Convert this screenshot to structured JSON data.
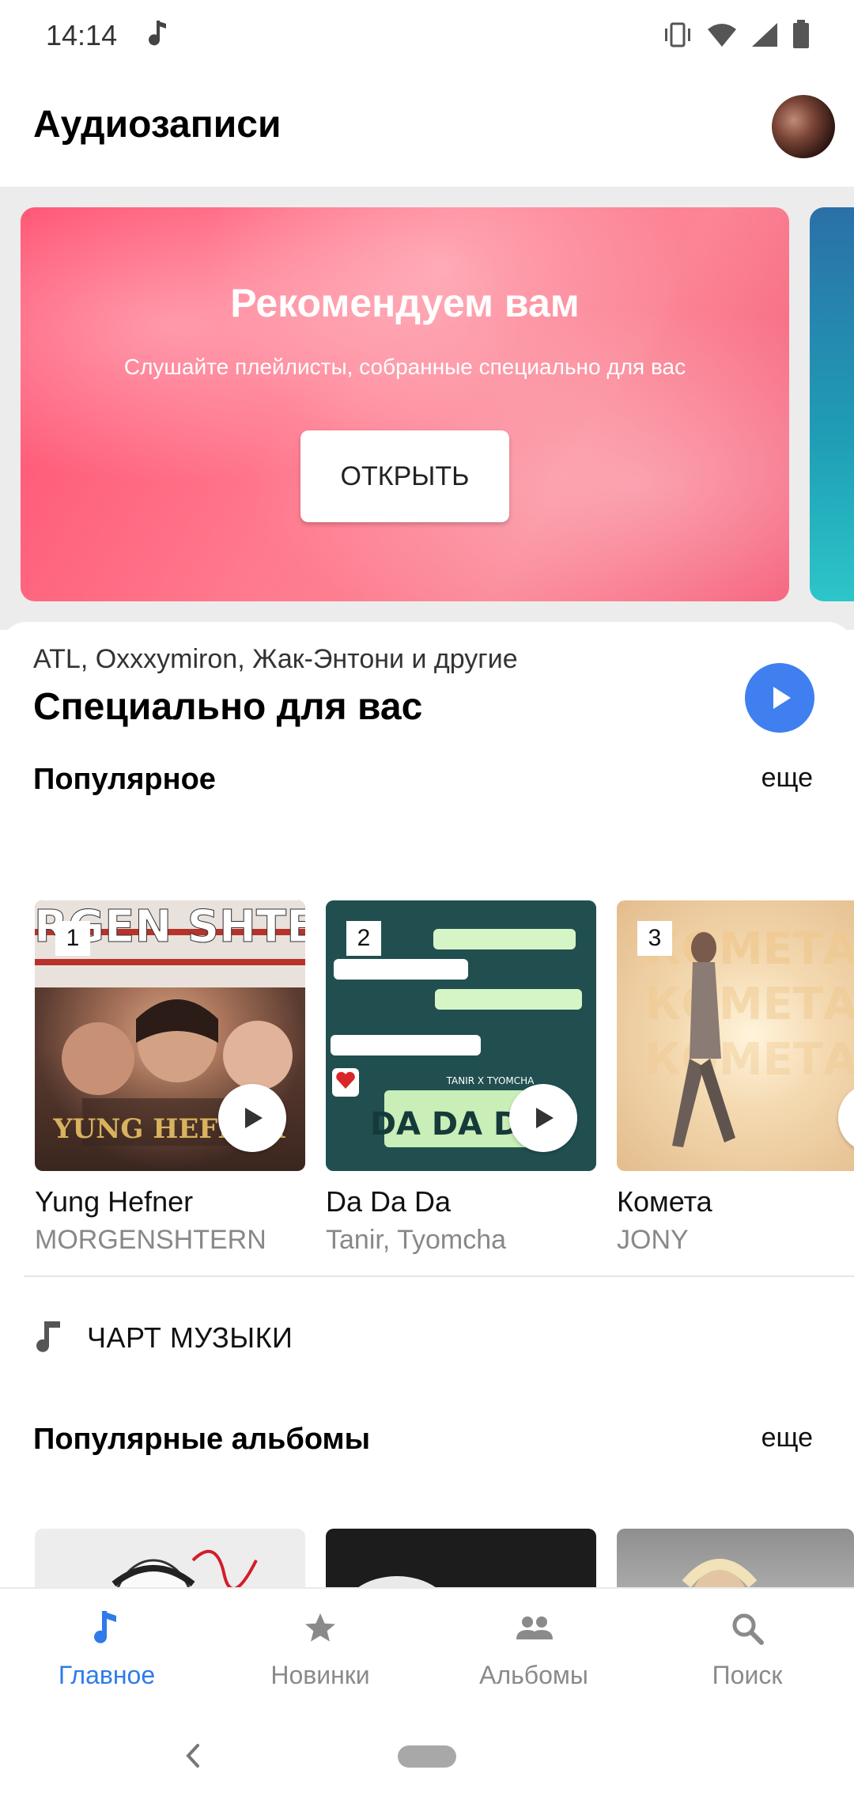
{
  "status": {
    "time": "14:14"
  },
  "header": {
    "title": "Аудиозаписи"
  },
  "banner": {
    "title": "Рекомендуем вам",
    "subtitle": "Слушайте плейлисты, собранные специально для вас",
    "button": "ОТКРЫТЬ"
  },
  "mix": {
    "artists": "ATL, Oxxxymiron, Жак-Энтони и другие",
    "title": "Специально для вас"
  },
  "popular": {
    "title": "Популярное",
    "more": "еще",
    "tracks": [
      {
        "rank": "1",
        "title": "Yung Hefner",
        "artist": "MORGENSHTERN",
        "cover_text": "MORGEN SHTERN",
        "cover_caption": "YUNG HEFNER"
      },
      {
        "rank": "2",
        "title": "Da Da Da",
        "artist": "Tanir, Tyomcha",
        "cover_text": "DA DA DA",
        "cover_caption": "TANIR X TYOMCHA"
      },
      {
        "rank": "3",
        "title": "Комета",
        "artist": "JONY",
        "cover_text": "КОМЕТА"
      }
    ]
  },
  "chart": {
    "label": "ЧАРТ МУЗЫКИ"
  },
  "albums": {
    "title": "Популярные альбомы",
    "more": "еще"
  },
  "nav": {
    "items": [
      {
        "label": "Главное",
        "icon": "music-note-icon",
        "active": true
      },
      {
        "label": "Новинки",
        "icon": "star-icon",
        "active": false
      },
      {
        "label": "Альбомы",
        "icon": "people-icon",
        "active": false
      },
      {
        "label": "Поиск",
        "icon": "search-icon",
        "active": false
      }
    ]
  },
  "colors": {
    "accent": "#3f7ff0",
    "banner_pink": "#ff5f7a",
    "nav_active": "#2f7bea"
  }
}
